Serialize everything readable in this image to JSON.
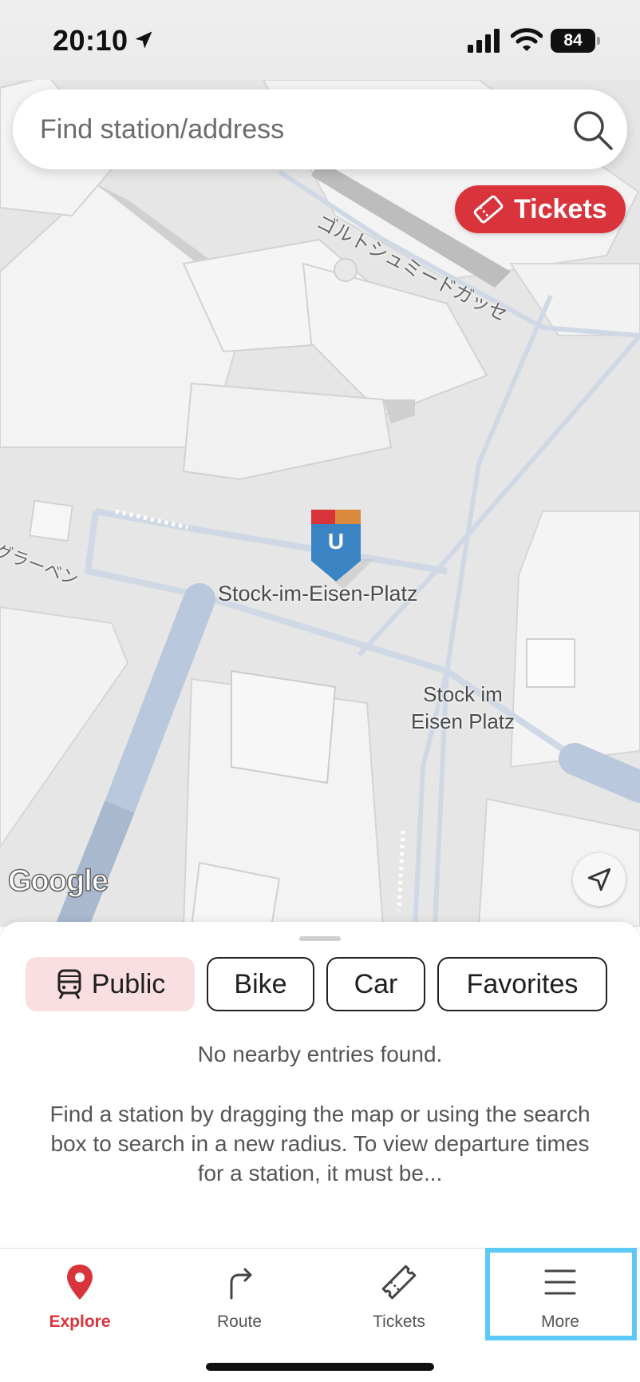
{
  "status_bar": {
    "time": "20:10",
    "battery": "84"
  },
  "search": {
    "placeholder": "Find station/address"
  },
  "tickets_button": {
    "label": "Tickets"
  },
  "map": {
    "station_label": "Stock-im-Eisen-Platz",
    "station_marker_letter": "U",
    "stop_label_line1": "Stock im",
    "stop_label_line2": "Eisen Platz",
    "street_label_1": "ゴルトシュミードガッセ",
    "street_label_2": "グラーベン",
    "attribution": "Google"
  },
  "sheet": {
    "modes": [
      {
        "label": "Public",
        "active": true
      },
      {
        "label": "Bike",
        "active": false
      },
      {
        "label": "Car",
        "active": false
      },
      {
        "label": "Favorites",
        "active": false
      }
    ],
    "empty_title": "No nearby entries found.",
    "empty_body": "Find a station by dragging the map or using the search box to search in a new radius. To view departure times for a station, it must be..."
  },
  "tabbar": {
    "tabs": [
      {
        "label": "Explore",
        "icon": "pin-icon",
        "active": true
      },
      {
        "label": "Route",
        "icon": "route-arrow-icon",
        "active": false
      },
      {
        "label": "Tickets",
        "icon": "ticket-icon",
        "active": false
      },
      {
        "label": "More",
        "icon": "hamburger-icon",
        "active": false,
        "highlighted": true
      }
    ]
  },
  "colors": {
    "accent": "#d9343c",
    "highlight": "#5bc8f5",
    "chip_active_bg": "#f9dfe2",
    "map_bg": "#e6e6e6",
    "route_line": "#b7c7dc",
    "ubahn_marker": "#3b84c4"
  }
}
